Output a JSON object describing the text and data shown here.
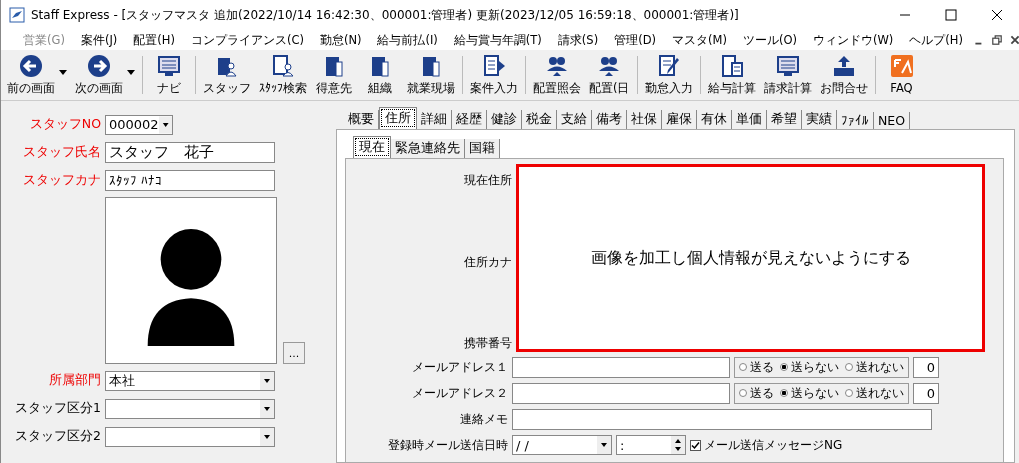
{
  "window": {
    "title": "Staff Express - [スタッフマスタ 追加(2022/10/14 16:42:30、000001:管理者) 更新(2023/12/05 16:59:18、000001:管理者)]"
  },
  "menu": [
    {
      "label": "営業(G)",
      "disabled": true
    },
    {
      "label": "案件(J)",
      "disabled": false
    },
    {
      "label": "配置(H)",
      "disabled": false
    },
    {
      "label": "コンプライアンス(C)",
      "disabled": false
    },
    {
      "label": "勤怠(N)",
      "disabled": false
    },
    {
      "label": "給与前払(I)",
      "disabled": false
    },
    {
      "label": "給与賞与年調(T)",
      "disabled": false
    },
    {
      "label": "請求(S)",
      "disabled": false
    },
    {
      "label": "管理(D)",
      "disabled": false
    },
    {
      "label": "マスタ(M)",
      "disabled": false
    },
    {
      "label": "ツール(O)",
      "disabled": false
    },
    {
      "label": "ウィンドウ(W)",
      "disabled": false
    },
    {
      "label": "ヘルプ(H)",
      "disabled": false
    }
  ],
  "toolbar": [
    {
      "label": "前の画面",
      "kind": "back",
      "dropdown": true
    },
    {
      "label": "次の画面",
      "kind": "forward",
      "dropdown": true
    },
    {
      "label": "ナビ",
      "kind": "screen",
      "dropdown": false
    },
    {
      "label": "スタッフ",
      "kind": "person",
      "dropdown": false
    },
    {
      "label": "ｽﾀｯﾌ検索",
      "kind": "doc-person",
      "dropdown": false
    },
    {
      "label": "得意先",
      "kind": "building",
      "dropdown": false
    },
    {
      "label": "組織",
      "kind": "building",
      "dropdown": false
    },
    {
      "label": "就業現場",
      "kind": "building",
      "dropdown": false
    },
    {
      "label": "案件入力",
      "kind": "doc-arrow",
      "dropdown": false
    },
    {
      "label": "配置照会",
      "kind": "people",
      "dropdown": false
    },
    {
      "label": "配置(日",
      "kind": "people",
      "dropdown": false
    },
    {
      "label": "勤怠入力",
      "kind": "pen",
      "dropdown": false
    },
    {
      "label": "給与計算",
      "kind": "calc",
      "dropdown": false
    },
    {
      "label": "請求計算",
      "kind": "screen",
      "dropdown": false
    },
    {
      "label": "お問合せ",
      "kind": "tray",
      "dropdown": false
    },
    {
      "label": "FAQ",
      "kind": "faq",
      "dropdown": false
    }
  ],
  "left": {
    "staff_no": {
      "label": "スタッフNO",
      "value": "000002"
    },
    "name": {
      "label": "スタッフ氏名",
      "value": "スタッフ　花子"
    },
    "kana": {
      "label": "スタッフカナ",
      "value": "ｽﾀｯﾌ ﾊﾅｺ"
    },
    "photo_button": "...",
    "fields": [
      {
        "label": "所属部門",
        "value": "本社",
        "required": true
      },
      {
        "label": "スタッフ区分1",
        "required": false
      },
      {
        "label": "スタッフ区分2",
        "required": false
      }
    ]
  },
  "tabs": [
    {
      "label": "概要",
      "selected": false
    },
    {
      "label": "住所",
      "selected": true
    },
    {
      "label": "詳細",
      "selected": false
    },
    {
      "label": "経歴",
      "selected": false
    },
    {
      "label": "健診",
      "selected": false
    },
    {
      "label": "税金",
      "selected": false
    },
    {
      "label": "支給",
      "selected": false
    },
    {
      "label": "備考",
      "selected": false
    },
    {
      "label": "社保",
      "selected": false
    },
    {
      "label": "雇保",
      "selected": false
    },
    {
      "label": "有休",
      "selected": false
    },
    {
      "label": "単価",
      "selected": false
    },
    {
      "label": "希望",
      "selected": false
    },
    {
      "label": "実績",
      "selected": false
    },
    {
      "label": "ﾌｧｲﾙ",
      "selected": false
    },
    {
      "label": "NEO",
      "selected": false
    }
  ],
  "subtabs": [
    {
      "label": "現在",
      "selected": true
    },
    {
      "label": "緊急連絡先",
      "selected": false
    },
    {
      "label": "国籍",
      "selected": false
    }
  ],
  "address": {
    "labels": [
      "現在住所",
      "住所カナ",
      "携帯番号"
    ],
    "mask_note": "画像を加工し個人情報が見えないようにする"
  },
  "mail_rows": [
    {
      "label": "メールアドレス１",
      "options": [
        {
          "label": "送る",
          "selected": false
        },
        {
          "label": "送らない",
          "selected": true
        },
        {
          "label": "送れない",
          "selected": false
        }
      ],
      "count": "0"
    },
    {
      "label": "メールアドレス２",
      "options": [
        {
          "label": "送る",
          "selected": false
        },
        {
          "label": "送らない",
          "selected": true
        },
        {
          "label": "送れない",
          "selected": false
        }
      ],
      "count": "0"
    }
  ],
  "memo": {
    "label": "連絡メモ"
  },
  "send_row": {
    "label": "登録時メール送信日時",
    "date": "/ /",
    "time": ":",
    "ng": {
      "label": "メール送信メッセージNG",
      "checked": true
    }
  }
}
